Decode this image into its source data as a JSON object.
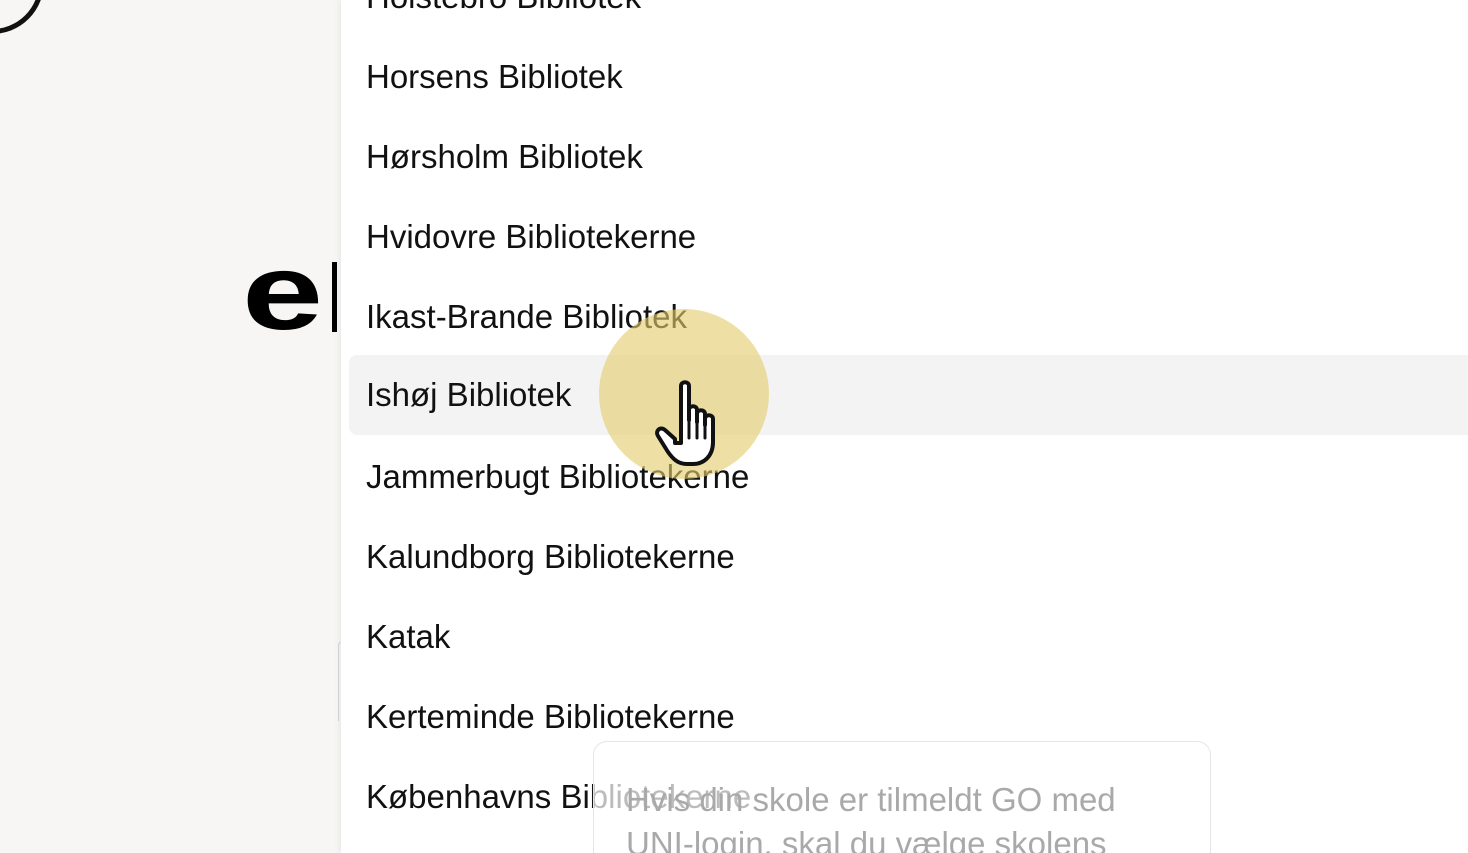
{
  "background": {
    "heading_fragment": "e"
  },
  "dropdown": {
    "options": [
      {
        "label": "Holstebro Bibliotek"
      },
      {
        "label": "Horsens Bibliotek"
      },
      {
        "label": "Hørsholm Bibliotek"
      },
      {
        "label": "Hvidovre Bibliotekerne"
      },
      {
        "label": "Ikast-Brande Bibliotek"
      },
      {
        "label": "Ishøj Bibliotek"
      },
      {
        "label": "Jammerbugt Bibliotekerne"
      },
      {
        "label": "Kalundborg Bibliotekerne"
      },
      {
        "label": "Katak"
      },
      {
        "label": "Kerteminde Bibliotekerne"
      },
      {
        "label": "Københavns Bibliotekerne"
      }
    ],
    "hovered_option": "Ishøj Bibliotek"
  },
  "tooltip": {
    "text": "Hvis din skole er tilmeldt GO med UNI-login, skal du vælge skolens"
  },
  "cursor": {
    "icon": "pointer-hand-icon",
    "highlight_color": "#e3cd6e"
  }
}
